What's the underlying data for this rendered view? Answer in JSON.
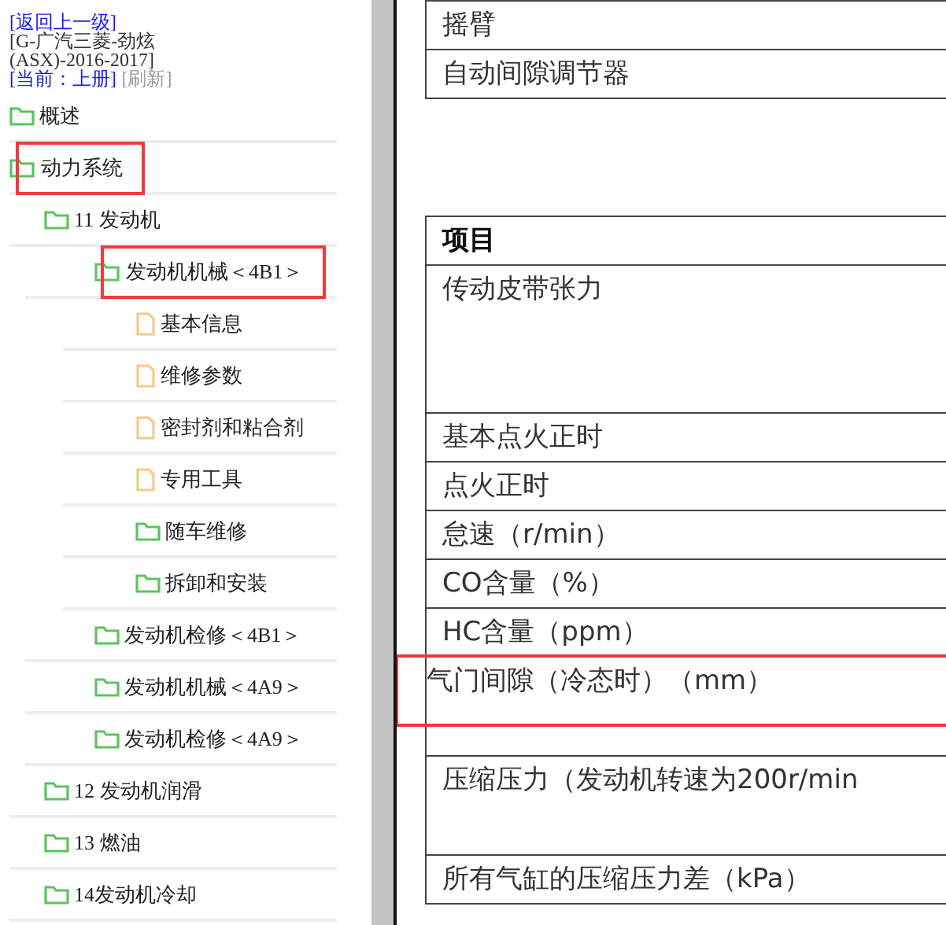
{
  "header": {
    "back_link": "[返回上一级]",
    "title": "[G-广汽三菱-劲炫(ASX)-2016-2017]",
    "current_link": "[当前：上册]",
    "refresh": "[刷新]"
  },
  "tree": [
    {
      "label": "概述",
      "kind": "folder",
      "marked": false
    },
    {
      "label": "动力系统",
      "kind": "folder",
      "marked": true,
      "children": [
        {
          "label": "11 发动机",
          "kind": "folder",
          "marked": false,
          "children": [
            {
              "label": "发动机机械＜4B1＞",
              "kind": "folder",
              "marked": true,
              "children": [
                {
                  "label": "基本信息",
                  "kind": "doc",
                  "marked": false
                },
                {
                  "label": "维修参数",
                  "kind": "doc",
                  "marked": false
                },
                {
                  "label": "密封剂和粘合剂",
                  "kind": "doc",
                  "marked": false
                },
                {
                  "label": "专用工具",
                  "kind": "doc",
                  "marked": false
                },
                {
                  "label": "随车维修",
                  "kind": "folder",
                  "marked": false
                },
                {
                  "label": "拆卸和安装",
                  "kind": "folder",
                  "marked": false
                }
              ]
            },
            {
              "label": "发动机检修＜4B1＞",
              "kind": "folder",
              "marked": false
            },
            {
              "label": "发动机机械＜4A9＞",
              "kind": "folder",
              "marked": false
            },
            {
              "label": "发动机检修＜4A9＞",
              "kind": "folder",
              "marked": false
            }
          ]
        },
        {
          "label": "12 发动机润滑",
          "kind": "folder",
          "marked": false
        },
        {
          "label": "13 燃油",
          "kind": "folder",
          "marked": false
        },
        {
          "label": "14发动机冷却",
          "kind": "folder",
          "marked": false
        }
      ]
    }
  ],
  "document": {
    "tables": [
      {
        "rows": [
          {
            "text": "摇臂",
            "kind": "cell",
            "marked": false
          },
          {
            "text": "自动间隙调节器",
            "kind": "cell",
            "marked": false
          }
        ]
      },
      {
        "rows": [
          {
            "text": "项目",
            "kind": "header",
            "marked": false
          },
          {
            "text": "传动皮带张力",
            "kind": "tall",
            "marked": false
          },
          {
            "text": "基本点火正时",
            "kind": "cell",
            "marked": false
          },
          {
            "text": "点火正时",
            "kind": "cell",
            "marked": false
          },
          {
            "text": "怠速（r/min）",
            "kind": "cell",
            "marked": false
          },
          {
            "text": "CO含量（%）",
            "kind": "cell",
            "marked": false
          },
          {
            "text": "HC含量（ppm）",
            "kind": "cell",
            "marked": false
          },
          {
            "text": "气门间隙（冷态时）（mm）",
            "kind": "double",
            "marked": true
          },
          {
            "text": "压缩压力（发动机转速为200r/min",
            "kind": "double",
            "marked": false
          },
          {
            "text": "所有气缸的压缩压力差（kPa）",
            "kind": "cell",
            "marked": false
          }
        ]
      }
    ]
  }
}
